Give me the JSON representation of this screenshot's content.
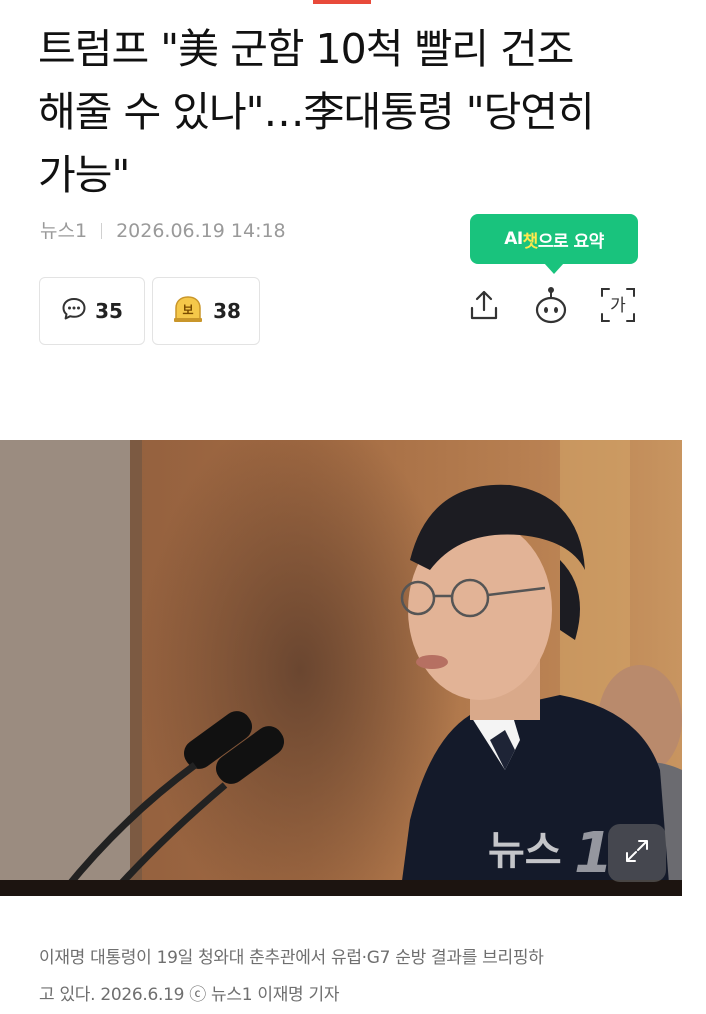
{
  "article": {
    "headline_line1": "트럼프 \"美 군함 10척 빨리 건조",
    "headline_line2": "해줄 수 있나\"…李대통령 \"당연히",
    "headline_line3": "가능\"",
    "source": "뉴스1",
    "datetime": "2026.06.19 14:18"
  },
  "ai_summary": {
    "prefix": "AI",
    "highlight": "챗",
    "suffix": "으로 요약"
  },
  "reactions": {
    "comments_count": "35",
    "reaction_count": "38",
    "reaction_badge_char": "보"
  },
  "toolbar": {
    "icons": [
      "share-icon",
      "ai-bot-icon",
      "font-size-icon"
    ],
    "font_size_char": "가"
  },
  "photo": {
    "watermark": "뉴스1",
    "watermark_visible": "뉴스"
  },
  "caption": {
    "line1": "이재명 대통령이 19일 청와대 춘추관에서 유럽·G7 순방 결과를 브리핑하",
    "line2": "고 있다. 2026.6.19 ⓒ 뉴스1 이재명 기자"
  },
  "colors": {
    "accent_red": "#e84a3a",
    "ai_green": "#19c37d",
    "badge_yellow": "#f5c84a"
  }
}
